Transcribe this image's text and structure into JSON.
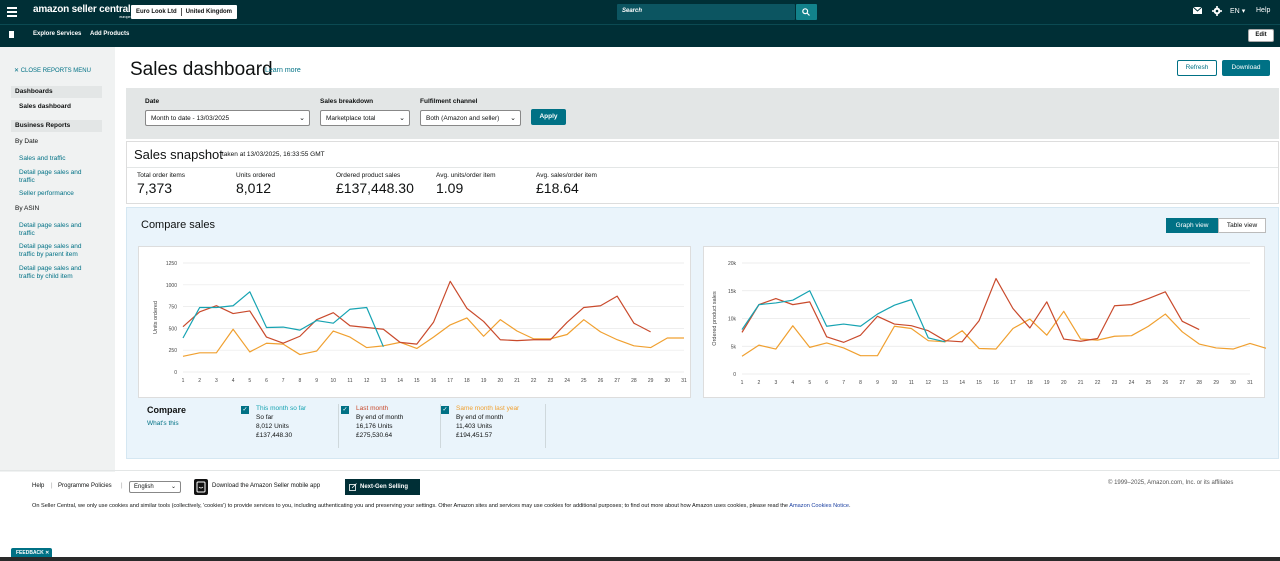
{
  "topbar": {
    "logo_text": "amazon seller central",
    "logo_sub": "europe",
    "account_name": "Euro Look Ltd",
    "marketplace": "United Kingdom",
    "search_placeholder": "Search",
    "language": "EN",
    "help_label": "Help"
  },
  "subbar": {
    "items": [
      "Explore Services",
      "Add Products"
    ],
    "edit_label": "Edit"
  },
  "sidebar": {
    "close_label": "CLOSE REPORTS MENU",
    "dashboards_header": "Dashboards",
    "dashboards_item": "Sales dashboard",
    "business_header": "Business Reports",
    "by_date_label": "By Date",
    "by_date_links": [
      "Sales and traffic",
      "Detail page sales and traffic",
      "Seller performance"
    ],
    "by_asin_label": "By ASIN",
    "by_asin_links": [
      "Detail page sales and traffic",
      "Detail page sales and traffic by parent item",
      "Detail page sales and traffic by child item"
    ]
  },
  "page": {
    "title": "Sales dashboard",
    "learn_more": "Learn more",
    "refresh_label": "Refresh",
    "download_label": "Download"
  },
  "filters": {
    "date_label": "Date",
    "date_value": "Month to date - 13/03/2025",
    "breakdown_label": "Sales breakdown",
    "breakdown_value": "Marketplace total",
    "channel_label": "Fulfilment channel",
    "channel_value": "Both (Amazon and seller)",
    "apply_label": "Apply"
  },
  "snapshot": {
    "title": "Sales snapshot",
    "taken_at": "taken at 13/03/2025, 16:33:55 GMT",
    "metrics": [
      {
        "label": "Total order items",
        "value": "7,373"
      },
      {
        "label": "Units ordered",
        "value": "8,012"
      },
      {
        "label": "Ordered product sales",
        "value": "£137,448.30"
      },
      {
        "label": "Avg. units/order item",
        "value": "1.09"
      },
      {
        "label": "Avg. sales/order item",
        "value": "£18.64"
      }
    ]
  },
  "compare": {
    "title": "Compare sales",
    "graph_view": "Graph view",
    "table_view": "Table view",
    "legend_title": "Compare",
    "whats_this": "What's this",
    "colors": {
      "this_month": "#16a3b2",
      "last_month": "#c94a2c",
      "last_year": "#f0a030"
    },
    "legend": [
      {
        "title": "This month so far",
        "line1": "So far",
        "line2": "8,012 Units",
        "line3": "£137,448.30"
      },
      {
        "title": "Last month",
        "line1": "By end of month",
        "line2": "16,176 Units",
        "line3": "£275,530.64"
      },
      {
        "title": "Same month last year",
        "line1": "By end of month",
        "line2": "11,403 Units",
        "line3": "£194,451.57"
      }
    ]
  },
  "chart_data": [
    {
      "type": "line",
      "ylabel": "Units ordered",
      "x": [
        1,
        2,
        3,
        4,
        5,
        6,
        7,
        8,
        9,
        10,
        11,
        12,
        13,
        14,
        15,
        16,
        17,
        18,
        19,
        20,
        21,
        22,
        23,
        24,
        25,
        26,
        27,
        28,
        29,
        30,
        31
      ],
      "yticks": [
        "0",
        "250",
        "500",
        "750",
        "1000",
        "1250"
      ],
      "ylim": [
        0,
        1250
      ],
      "series": [
        {
          "name": "This month so far",
          "values": [
            390,
            740,
            740,
            760,
            920,
            510,
            515,
            480,
            590,
            560,
            720,
            740,
            290
          ]
        },
        {
          "name": "Last month",
          "values": [
            520,
            690,
            760,
            670,
            700,
            400,
            330,
            410,
            600,
            680,
            530,
            510,
            490,
            340,
            320,
            570,
            1040,
            730,
            580,
            370,
            360,
            370,
            370,
            570,
            740,
            760,
            870,
            560,
            460
          ]
        },
        {
          "name": "Same month last year",
          "values": [
            180,
            220,
            220,
            490,
            230,
            330,
            320,
            200,
            240,
            470,
            400,
            280,
            300,
            340,
            270,
            400,
            540,
            620,
            410,
            600,
            470,
            380,
            380,
            430,
            600,
            460,
            370,
            300,
            280,
            390,
            390
          ]
        }
      ]
    },
    {
      "type": "line",
      "ylabel": "Ordered product sales",
      "x": [
        1,
        2,
        3,
        4,
        5,
        6,
        7,
        8,
        9,
        10,
        11,
        12,
        13,
        14,
        15,
        16,
        17,
        18,
        19,
        20,
        21,
        22,
        23,
        24,
        25,
        26,
        27,
        28,
        29,
        30,
        31
      ],
      "yticks": [
        "0",
        "5k",
        "10k",
        "15k",
        "20k"
      ],
      "ylim": [
        0,
        20000
      ],
      "series": [
        {
          "name": "This month so far",
          "values": [
            8000,
            12500,
            12800,
            13300,
            15000,
            8600,
            9000,
            8600,
            10800,
            12400,
            13400,
            6500,
            5800
          ]
        },
        {
          "name": "Last month",
          "values": [
            7500,
            12500,
            13600,
            12500,
            13000,
            6700,
            5700,
            7000,
            10400,
            9000,
            8700,
            7800,
            6000,
            5800,
            9600,
            17200,
            11800,
            8300,
            13000,
            6300,
            5900,
            6400,
            12300,
            12500,
            13600,
            14800,
            9500,
            8000
          ]
        },
        {
          "name": "Same month last year",
          "values": [
            3200,
            5200,
            4500,
            8700,
            4800,
            5600,
            4700,
            3300,
            3300,
            8600,
            8200,
            6000,
            5800,
            7800,
            4600,
            4500,
            8200,
            9900,
            7000,
            11300,
            6300,
            6100,
            6800,
            6900,
            8600,
            10800,
            7600,
            5400,
            4700,
            4500,
            5500,
            4600
          ]
        }
      ]
    }
  ],
  "footer": {
    "help": "Help",
    "programme_policies": "Programme Policies",
    "language_value": "English",
    "mobile_app": "Download the Amazon Seller mobile app",
    "next_gen": "Next-Gen Selling",
    "copyright": "© 1999–2025, Amazon.com, Inc. or its affiliates",
    "cookie_text": "On Seller Central, we only use cookies and similar tools (collectively, 'cookies') to provide services to you, including authenticating you and preserving your settings. Other Amazon sites and services may use cookies for additional purposes; to find out more about how Amazon uses cookies, please read the",
    "cookie_link": "Amazon Cookies Notice",
    "feedback": "FEEDBACK"
  }
}
